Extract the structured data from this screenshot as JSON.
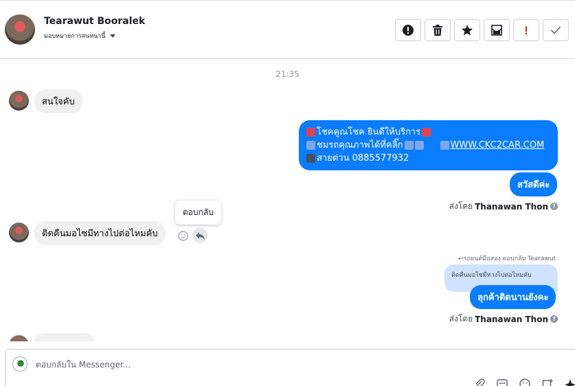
{
  "header": {
    "contact_name": "Tearawut Booralek",
    "assign_label": "มอบหมายการสนทนานี้",
    "toolbar_icons": [
      "alert-icon",
      "trash-icon",
      "star-icon",
      "mark-unread-icon",
      "spam-icon",
      "check-icon"
    ]
  },
  "chat": {
    "timestamp": "21:35",
    "messages": [
      {
        "direction": "in",
        "text": "สนใจคับ"
      },
      {
        "direction": "out",
        "lines": [
          "โชคคูณโชค ยินดีให้บริการ",
          "ชมรถคุณภาพได้ที่คลิ๊ก",
          "WWW.CKC2CAR.COM",
          "สายด่วน 0885577932"
        ]
      },
      {
        "direction": "out",
        "text": "สวัสดีค่ะ"
      },
      {
        "direction": "in",
        "text": "ติดคืนมอไซมีทางไปต่อไหมคับ"
      },
      {
        "direction": "out",
        "reply_to": "ติดคืนมอไซมีทางไปต่อไหมคับ",
        "text": "ลุกค้าติดนานยังคะ"
      }
    ],
    "sent_by_prefix": "ส่งโดย",
    "sent_by_name": "Thanawan Thon",
    "help_mark": "?",
    "tooltip": "ตอบกลับ",
    "reply_label": "รถยนต์มือสอง ตอบกลับ Tearawut"
  },
  "composer": {
    "placeholder": "ตอบกลับใน Messenger...",
    "value": "",
    "tool_icons": [
      "attachment-icon",
      "gif-icon",
      "emoji-icon",
      "saved-reply-icon",
      "more-icon"
    ]
  },
  "colors": {
    "outgoing_bubble": "#0a7cff",
    "incoming_bubble": "#f0f0f0",
    "quoted_bubble": "#cfe2ff",
    "spam_red": "#e02020"
  }
}
